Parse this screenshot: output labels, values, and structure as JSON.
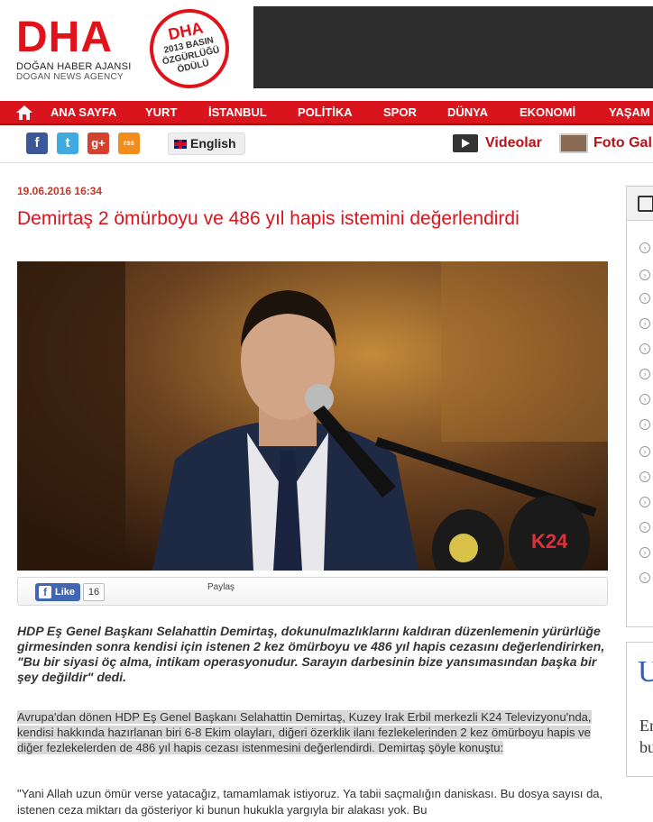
{
  "header": {
    "logo_text": "DHA",
    "logo_sub_tr": "DOĞAN HABER AJANSI",
    "logo_sub_en": "DOGAN NEWS AGENCY",
    "award_title": "DHA",
    "award_line1": "2013 BASIN",
    "award_line2": "ÖZGÜRLÜĞÜ",
    "award_line3": "ÖDÜLÜ"
  },
  "nav": {
    "home_icon": "home-icon",
    "items": [
      "ANA SAYFA",
      "YURT",
      "İSTANBUL",
      "POLİTİKA",
      "SPOR",
      "DÜNYA",
      "EKONOMİ",
      "YAŞAM"
    ]
  },
  "social": {
    "facebook": "f",
    "twitter": "t",
    "googleplus": "g+",
    "rss": "rss",
    "language_label": "English",
    "videos_label": "Videolar",
    "photo_gallery_label": "Foto Gal"
  },
  "article": {
    "date": "19.06.2016 16:34",
    "title": "Demirtaş 2 ömürboyu ve 486 yıl hapis istemini değerlendirdi",
    "like_label": "Like",
    "like_count": "16",
    "share_label": "Paylaş",
    "lead": "HDP Eş Genel Başkanı Selahattin Demirtaş, dokunulmazlıklarını kaldıran düzenlemenin yürürlüğe girmesinden sonra kendisi için istenen 2 kez ömürboyu ve 486 yıl hapis cezasını değerlendirirken, \"Bu bir siyasi öç alma, intikam operasyonudur. Sarayın darbesinin bize yansımasından başka bir şey değildir\" dedi.",
    "paragraph1": "Avrupa'dan dönen HDP Eş Genel Başkanı Selahattin Demirtaş, Kuzey Irak Erbil merkezli K24 Televizyonu'nda, kendisi hakkında hazırlanan biri 6-8 Ekim olayları, diğeri özerklik ilanı fezlekelerinden 2 kez ömürboyu hapis ve diğer fezlekelerden de 486 yıl hapis cezası istenmesini değerlendirdi. Demirtaş şöyle konuştu:",
    "paragraph2": "\"Yani Allah uzun ömür verse yatacağız, tamamlamak istiyoruz. Ya tabii saçmalığın daniskası. Bu dosya sayısı da, istenen ceza miktarı da gösteriyor ki bunun hukukla yargıyla bir alakası yok. Bu"
  },
  "sidebar": {
    "box2_letter": "U",
    "box2_text_line1": "Er",
    "box2_text_line2": "bu"
  },
  "colors": {
    "brand_red": "#d9141c",
    "nav_text": "#ffffff",
    "title_red": "#d9141c",
    "facebook_blue": "#3b5998"
  }
}
